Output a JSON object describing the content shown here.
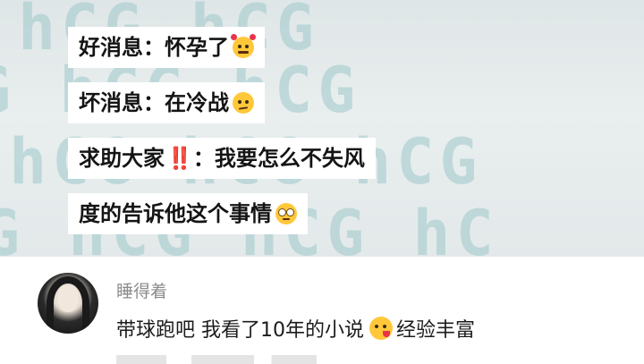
{
  "post": {
    "lines": [
      {
        "text": "好消息：怀孕了",
        "emoji": "smiling-face-with-hearts-icon"
      },
      {
        "text": "坏消息：在冷战",
        "emoji": "neutral-face-icon"
      },
      {
        "text_before": "求助大家",
        "emphasis": "‼️",
        "text_after": "：我要怎么不失风"
      },
      {
        "text": "度的告诉他这个事情",
        "emoji": "rolling-eyes-icon"
      }
    ]
  },
  "comment": {
    "username": "睡得着",
    "text_before": "带球跑吧  我看了10年的小说",
    "emoji": "yum-face-icon",
    "text_after": "经验丰富"
  },
  "colors": {
    "watermark": "#9fc9cc",
    "emphasis": "#e0242c",
    "username": "#8a8a8a"
  }
}
